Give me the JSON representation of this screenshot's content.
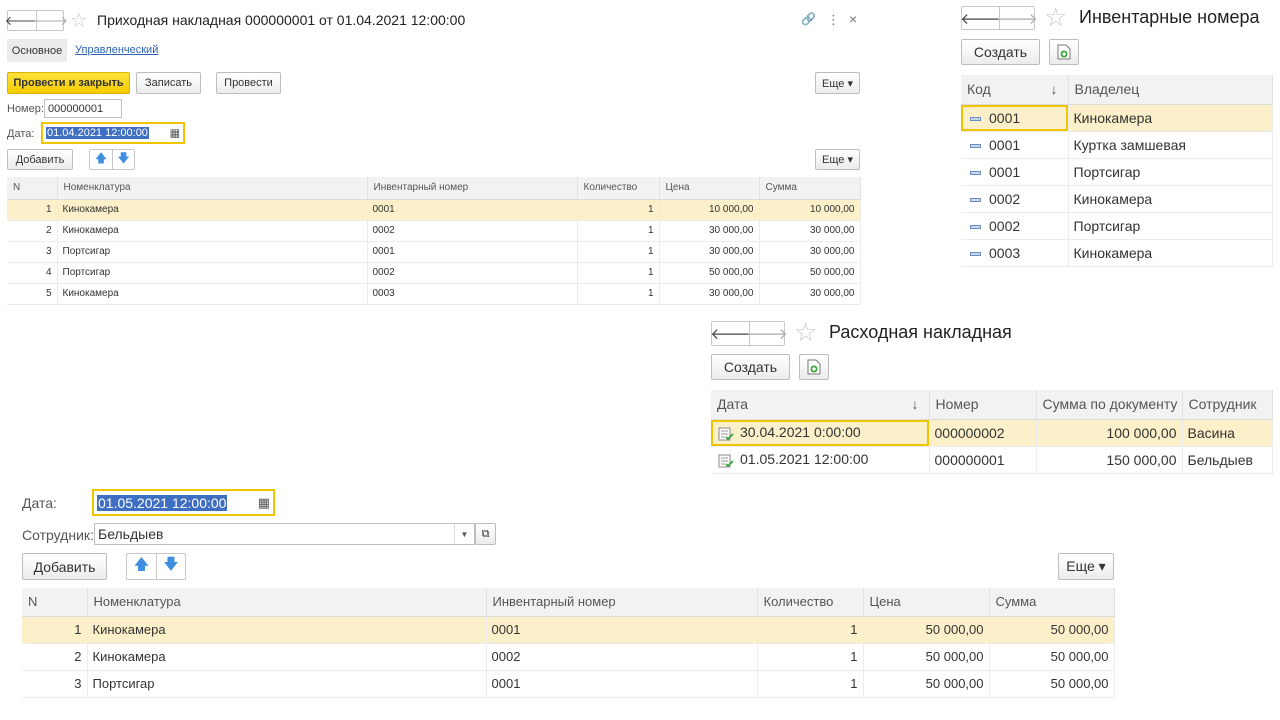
{
  "receipt": {
    "title": "Приходная накладная 000000001 от 01.04.2021 12:00:00",
    "window_controls": {
      "link": "🔗",
      "more": "⋮",
      "close": "×"
    },
    "tabs": [
      {
        "label": "Основное"
      },
      {
        "label": "Управленческий"
      }
    ],
    "toolbar": {
      "post_close": "Провести и закрыть",
      "save": "Записать",
      "post": "Провести",
      "more": "Еще ▾"
    },
    "number_label": "Номер:",
    "number_value": "000000001",
    "date_label": "Дата:",
    "date_value": "01.04.2021 12:00:00",
    "add_button": "Добавить",
    "table_more": "Еще ▾",
    "columns": [
      "N",
      "Номенклатура",
      "Инвентарный номер",
      "Количество",
      "Цена",
      "Сумма"
    ],
    "rows": [
      {
        "n": "1",
        "item": "Кинокамера",
        "inv": "0001",
        "qty": "1",
        "price": "10 000,00",
        "sum": "10 000,00"
      },
      {
        "n": "2",
        "item": "Кинокамера",
        "inv": "0002",
        "qty": "1",
        "price": "30 000,00",
        "sum": "30 000,00"
      },
      {
        "n": "3",
        "item": "Портсигар",
        "inv": "0001",
        "qty": "1",
        "price": "30 000,00",
        "sum": "30 000,00"
      },
      {
        "n": "4",
        "item": "Портсигар",
        "inv": "0002",
        "qty": "1",
        "price": "50 000,00",
        "sum": "50 000,00"
      },
      {
        "n": "5",
        "item": "Кинокамера",
        "inv": "0003",
        "qty": "1",
        "price": "30 000,00",
        "sum": "30 000,00"
      }
    ]
  },
  "inventory": {
    "title": "Инвентарные номера",
    "create_button": "Создать",
    "columns": [
      "Код",
      "Владелец"
    ],
    "sort_indicator": "↓",
    "rows": [
      {
        "code": "0001",
        "owner": "Кинокамера"
      },
      {
        "code": "0001",
        "owner": "Куртка замшевая"
      },
      {
        "code": "0001",
        "owner": "Портсигар"
      },
      {
        "code": "0002",
        "owner": "Кинокамера"
      },
      {
        "code": "0002",
        "owner": "Портсигар"
      },
      {
        "code": "0003",
        "owner": "Кинокамера"
      }
    ]
  },
  "expense_list": {
    "title": "Расходная накладная",
    "create_button": "Создать",
    "columns": [
      "Дата",
      "Номер",
      "Сумма по документу",
      "Сотрудник"
    ],
    "sort_indicator": "↓",
    "rows": [
      {
        "date": "30.04.2021 0:00:00",
        "number": "000000002",
        "sum": "100 000,00",
        "employee": "Васина"
      },
      {
        "date": "01.05.2021 12:00:00",
        "number": "000000001",
        "sum": "150 000,00",
        "employee": "Бельдыев"
      }
    ]
  },
  "expense_doc": {
    "date_label": "Дата:",
    "date_value": "01.05.2021 12:00:00",
    "employee_label": "Сотрудник:",
    "employee_value": "Бельдыев",
    "add_button": "Добавить",
    "table_more": "Еще ▾",
    "columns": [
      "N",
      "Номенклатура",
      "Инвентарный номер",
      "Количество",
      "Цена",
      "Сумма"
    ],
    "rows": [
      {
        "n": "1",
        "item": "Кинокамера",
        "inv": "0001",
        "qty": "1",
        "price": "50 000,00",
        "sum": "50 000,00"
      },
      {
        "n": "2",
        "item": "Кинокамера",
        "inv": "0002",
        "qty": "1",
        "price": "50 000,00",
        "sum": "50 000,00"
      },
      {
        "n": "3",
        "item": "Портсигар",
        "inv": "0001",
        "qty": "1",
        "price": "50 000,00",
        "sum": "50 000,00"
      }
    ]
  },
  "colors": {
    "accent_yellow": "#f5cc00",
    "row_highlight": "#fbf0c9",
    "selection_blue": "#3f6fc2",
    "arrow_blue": "#3f8ee0"
  },
  "icons": [
    "back-arrow-icon",
    "forward-arrow-icon",
    "star-icon",
    "link-icon",
    "more-vertical-icon",
    "close-icon",
    "calendar-icon",
    "move-up-icon",
    "move-down-icon",
    "copy-document-icon",
    "catalog-item-icon",
    "posted-document-icon",
    "dropdown-icon",
    "open-form-icon"
  ]
}
